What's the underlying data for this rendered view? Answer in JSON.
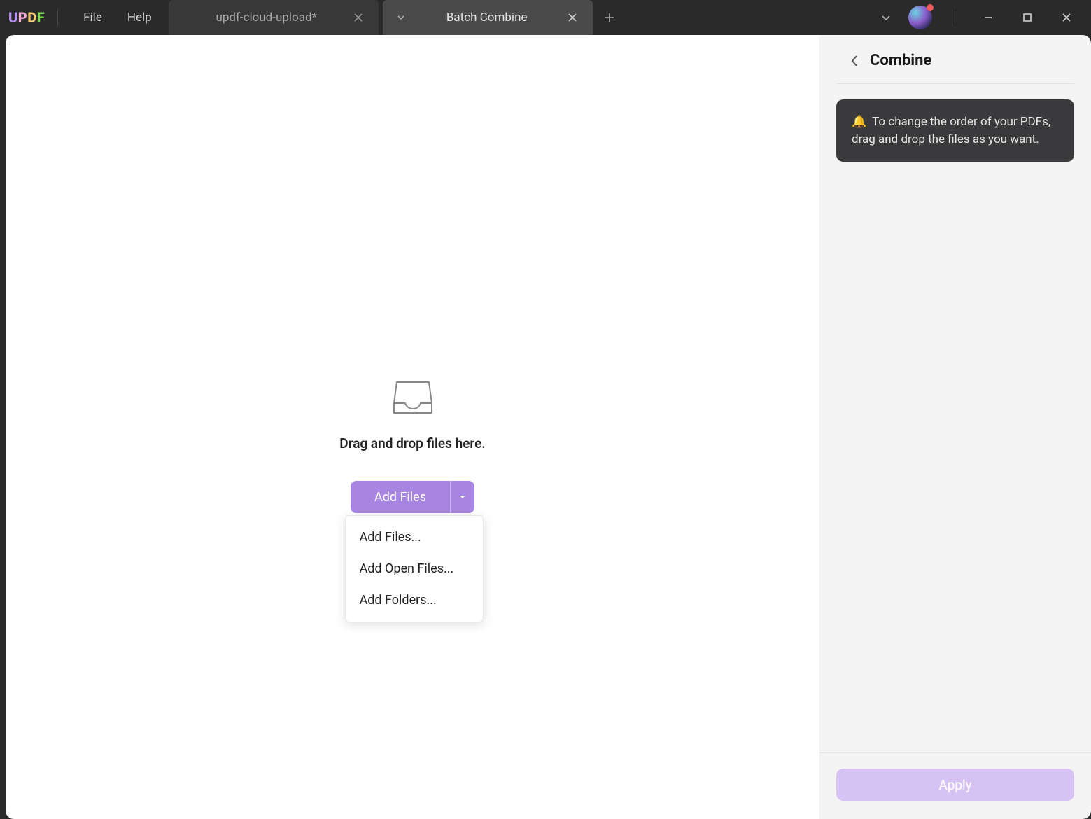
{
  "app": {
    "logo": {
      "u": "U",
      "p": "P",
      "d": "D",
      "f": "F"
    }
  },
  "menu": {
    "file": "File",
    "help": "Help"
  },
  "tabs": {
    "inactive": {
      "label": "updf-cloud-upload*"
    },
    "active": {
      "label": "Batch Combine"
    }
  },
  "main": {
    "drop_text": "Drag and drop files here.",
    "add_files_label": "Add Files",
    "dropdown": {
      "add_files": "Add Files...",
      "add_open_files": "Add Open Files...",
      "add_folders": "Add Folders..."
    }
  },
  "side": {
    "title": "Combine",
    "tip_emoji": "🔔",
    "tip_text": "To change the order of your PDFs, drag and drop the files as you want.",
    "apply_label": "Apply"
  }
}
